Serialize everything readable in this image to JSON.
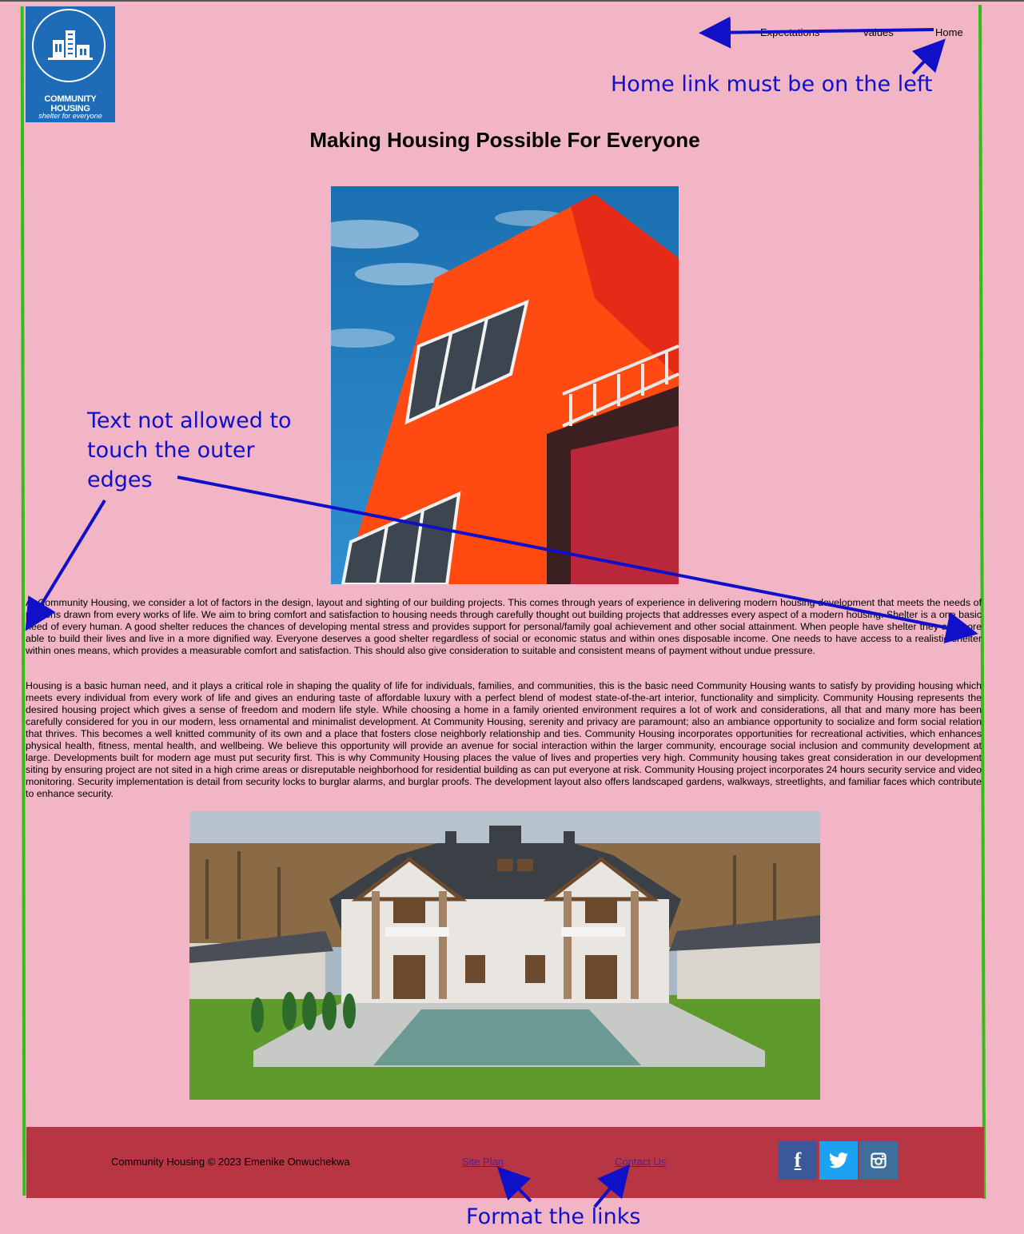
{
  "brand": {
    "logo_name": "COMMUNITY HOUSING",
    "logo_tagline": "shelter for everyone"
  },
  "nav": {
    "items": [
      {
        "label": "Expectations"
      },
      {
        "label": "Values"
      },
      {
        "label": "Home"
      }
    ]
  },
  "annotations": {
    "home_note": "Home link must be on the left",
    "text_note": "Text not allowed to touch the outer edges",
    "links_note": "Format the links"
  },
  "page": {
    "title": "Making Housing Possible For Everyone",
    "paragraph1": "At Community Housing, we consider a lot of factors in the design, layout and sighting of our building projects. This comes through years of experience in delivering modern housing development that meets the needs of persons drawn from every works of life. We aim to bring comfort and satisfaction to housing needs through carefully thought out building projects that addresses every aspect of a modern housing. Shelter is a one basic need of every human. A good shelter reduces the chances of developing mental stress and provides support for personal/family goal achievement and other social attainment. When people have shelter they are more able to build their lives and live in a more dignified way. Everyone deserves a good shelter regardless of social or economic status and within ones disposable income. One needs to have access to a realistic shelter within ones means, which provides a measurable comfort and satisfaction. This should also give consideration to suitable and consistent means of payment without undue pressure.",
    "paragraph2": "Housing is a basic human need, and it plays a critical role in shaping the quality of life for individuals, families, and communities, this is the basic need Community Housing wants to satisfy by providing housing which meets every individual from every work of life and gives an enduring taste of affordable luxury with a perfect blend of modest state-of-the-art interior, functionality and simplicity. Community Housing represents the desired housing project which gives a sense of freedom and modern life style. While choosing a home in a family oriented environment requires a lot of work and considerations, all that and many more has been carefully considered for you in our modern, less ornamental and minimalist development. At Community Housing, serenity and privacy are paramount; also an ambiance opportunity to socialize and form social relation that thrives. This becomes a well knitted community of its own and a place that fosters close neighborly relationship and ties. Community Housing incorporates opportunities for recreational activities, which enhances physical health, fitness, mental health, and wellbeing. We believe this opportunity will provide an avenue for social interaction within the larger community, encourage social inclusion and community development at large. Developments built for modern age must put security first. This is why Community Housing places the value of lives and properties very high. Community housing takes great consideration in our development siting by ensuring project are not sited in a high crime areas or disreputable neighborhood for residential building as can put everyone at risk. Community Housing project incorporates 24 hours security service and video monitoring. Security implementation is detail from security locks to burglar alarms, and burglar proofs. The development layout also offers landscaped gardens, walkways, streetlights, and familiar faces which contribute to enhance security."
  },
  "footer": {
    "copyright": "Community Housing © 2023 Emenike Onwuchekwa",
    "links": [
      {
        "label": "Site Plan"
      },
      {
        "label": "Contact Us"
      }
    ],
    "social": [
      {
        "icon": "facebook-icon",
        "glyph": "f",
        "color": "#3b5998"
      },
      {
        "icon": "twitter-icon",
        "color": "#1da1f2"
      },
      {
        "icon": "instagram-icon",
        "color": "#3e6e9a"
      }
    ]
  },
  "colors": {
    "page_bg": "#f1b5c5",
    "footer_bg": "#b83644",
    "annotation": "#1010c8",
    "guide_line": "#2fbf17",
    "link_visited": "#4f1f96"
  }
}
